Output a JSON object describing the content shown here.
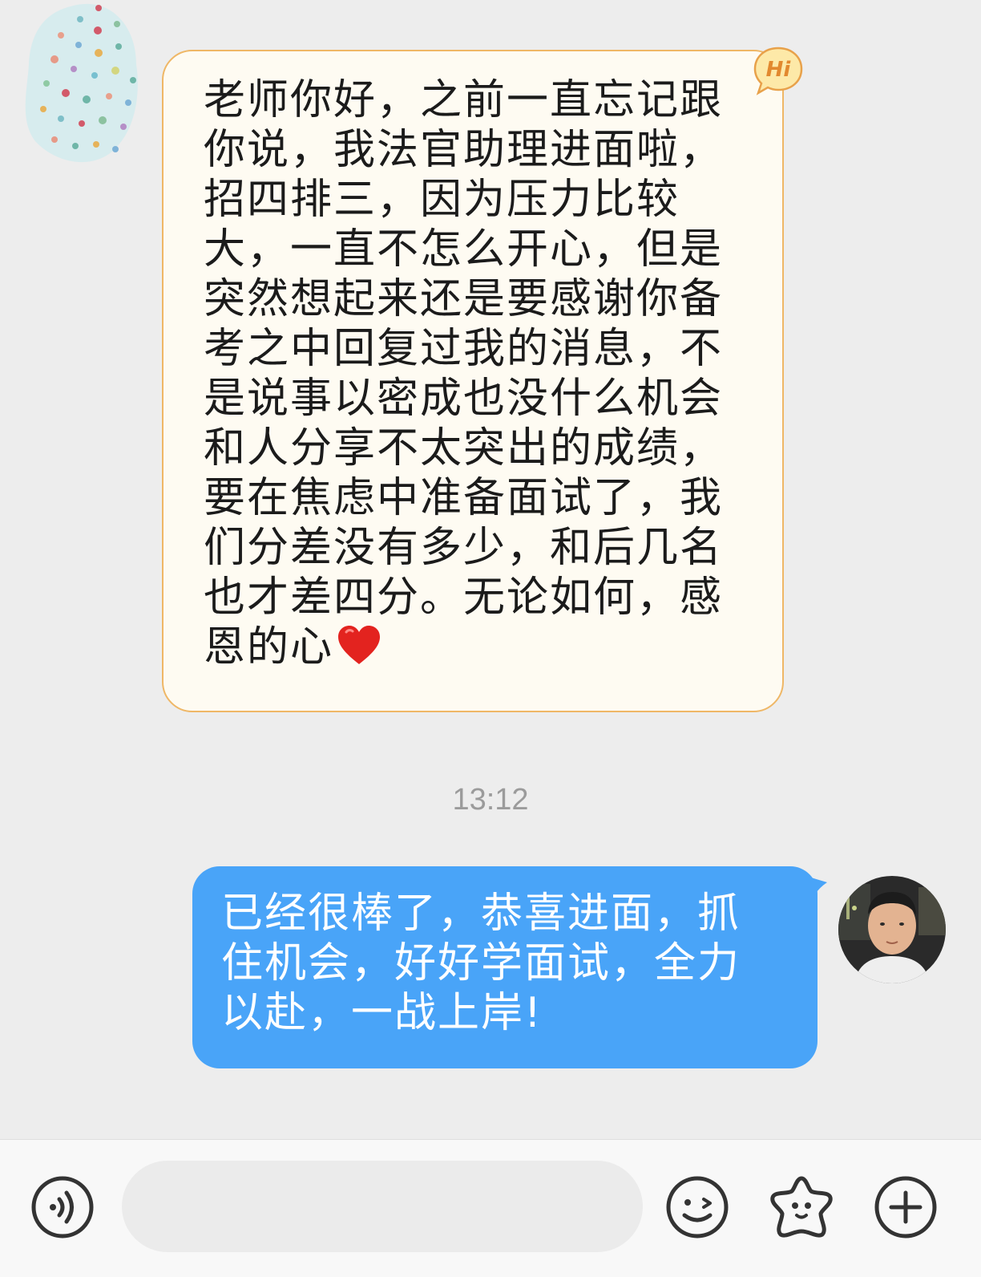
{
  "conversation": {
    "incoming_message": {
      "text": "老师你好，之前一直忘记跟你说，我法官助理进面啦，招四排三，因为压力比较大，一直不怎么开心，但是突然想起来还是要感谢你备考之中回复过我的消息，不是说事以密成也没什么机会和人分享不太突出的成绩，要在焦虑中准备面试了，我们分差没有多少，和后几名也才差四分。无论如何，感恩的心",
      "emoji": "heart-icon",
      "badge_text": "Hi",
      "bubble_color": "#fefbf2",
      "bubble_border": "#efb766"
    },
    "timestamp": "13:12",
    "outgoing_message": {
      "text": "已经很棒了，恭喜进面，抓住机会，好好学面试，全力以赴，一战上岸!",
      "bubble_color": "#49a4f8"
    }
  },
  "input_bar": {
    "voice_icon": "voice-icon",
    "input_placeholder": "",
    "emoji_icon": "emoji-icon",
    "sticker_icon": "sticker-icon",
    "more_icon": "plus-icon"
  }
}
